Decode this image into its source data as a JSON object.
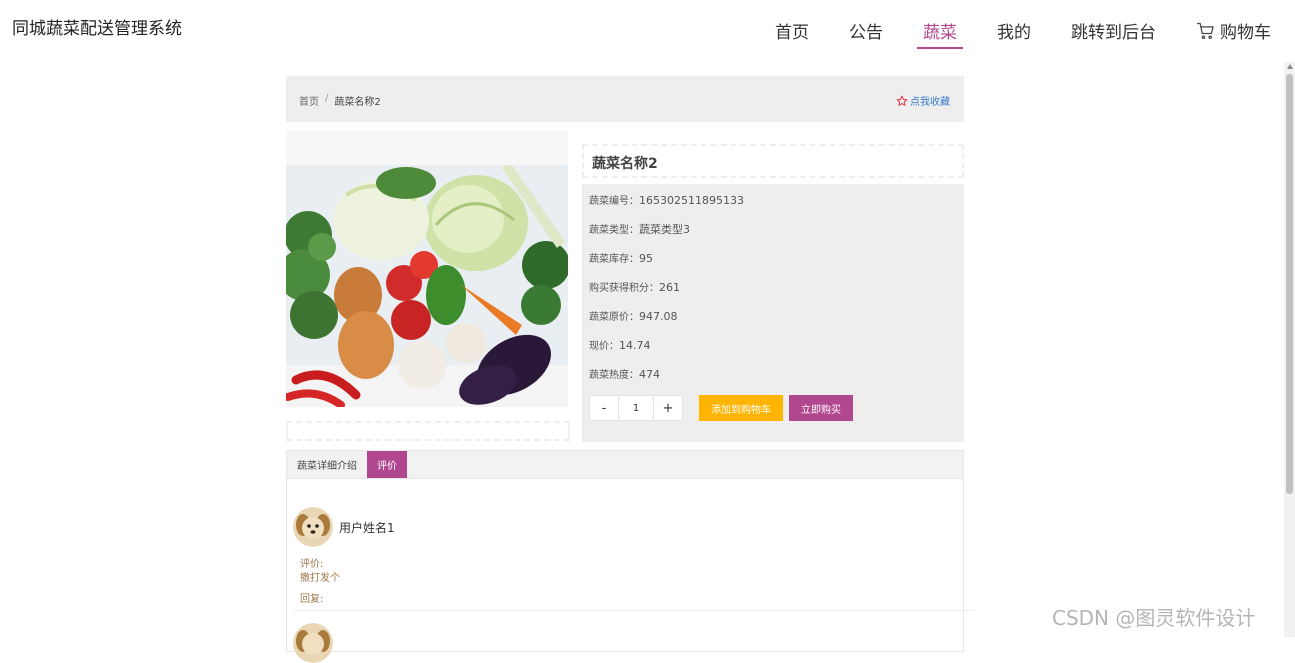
{
  "header": {
    "site_title": "同城蔬菜配送管理系统",
    "nav": {
      "home": "首页",
      "notice": "公告",
      "vegetables": "蔬菜",
      "mine": "我的",
      "backend": "跳转到后台",
      "cart": "购物车"
    },
    "active_color": "#b1478f"
  },
  "breadcrumb": {
    "home": "首页",
    "separator": "/",
    "current": "蔬菜名称2",
    "favorite": "点我收藏"
  },
  "product": {
    "name": "蔬菜名称2",
    "fields": [
      {
        "label": "蔬菜编号：",
        "value": "165302511895133"
      },
      {
        "label": "蔬菜类型：",
        "value": "蔬菜类型3"
      },
      {
        "label": "蔬菜库存：",
        "value": "95"
      },
      {
        "label": "购买获得积分：",
        "value": "261"
      },
      {
        "label": "蔬菜原价：",
        "value": "947.08"
      },
      {
        "label": "现价：",
        "value": "14.74"
      },
      {
        "label": "蔬菜热度：",
        "value": "474"
      }
    ],
    "quantity": {
      "minus": "-",
      "value": "1",
      "plus": "+"
    },
    "add_to_cart": "添加到购物车",
    "buy_now": "立即购买",
    "colors": {
      "cart_button": "#ffb400",
      "buy_button": "#b1478f"
    }
  },
  "tabs": {
    "detail": "蔬菜详细介绍",
    "review": "评价"
  },
  "review": {
    "user": "用户姓名1",
    "label": "评价:",
    "content": "撒打发个",
    "reply_label": "回复:"
  },
  "watermark": "CSDN @图灵软件设计"
}
